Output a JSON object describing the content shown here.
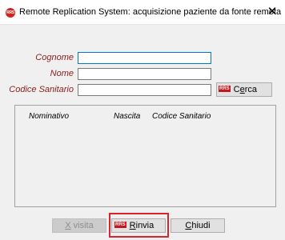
{
  "window": {
    "title": "Remote Replication System: acquisizione paziente da fonte remota",
    "app_icon_text": "RRS",
    "close_glyph": "✕"
  },
  "form": {
    "cognome_label": "Cognome",
    "cognome_value": "",
    "nome_label": "Nome",
    "nome_value": "",
    "codice_label": "Codice Sanitario",
    "codice_value": "",
    "cerca_badge": "RRS",
    "cerca_label_pre": "C",
    "cerca_label_ul": "e",
    "cerca_label_post": "rca"
  },
  "results": {
    "columns": [
      "Nominativo",
      "Nascita",
      "Codice Sanitario"
    ],
    "rows": []
  },
  "footer": {
    "visita_ul": "X",
    "visita_post": " visita",
    "rinvia_badge": "RRS",
    "rinvia_ul": "R",
    "rinvia_post": "invia",
    "chiudi_ul": "C",
    "chiudi_post": "hiudi"
  },
  "colors": {
    "label": "#8b1c1c",
    "highlight_box": "#d9232d",
    "focus_border": "#0078d7",
    "badge": "#c4161c"
  },
  "icons": {
    "app": "rrs-app-icon",
    "close": "close-icon",
    "badge": "rrs-badge-icon"
  }
}
